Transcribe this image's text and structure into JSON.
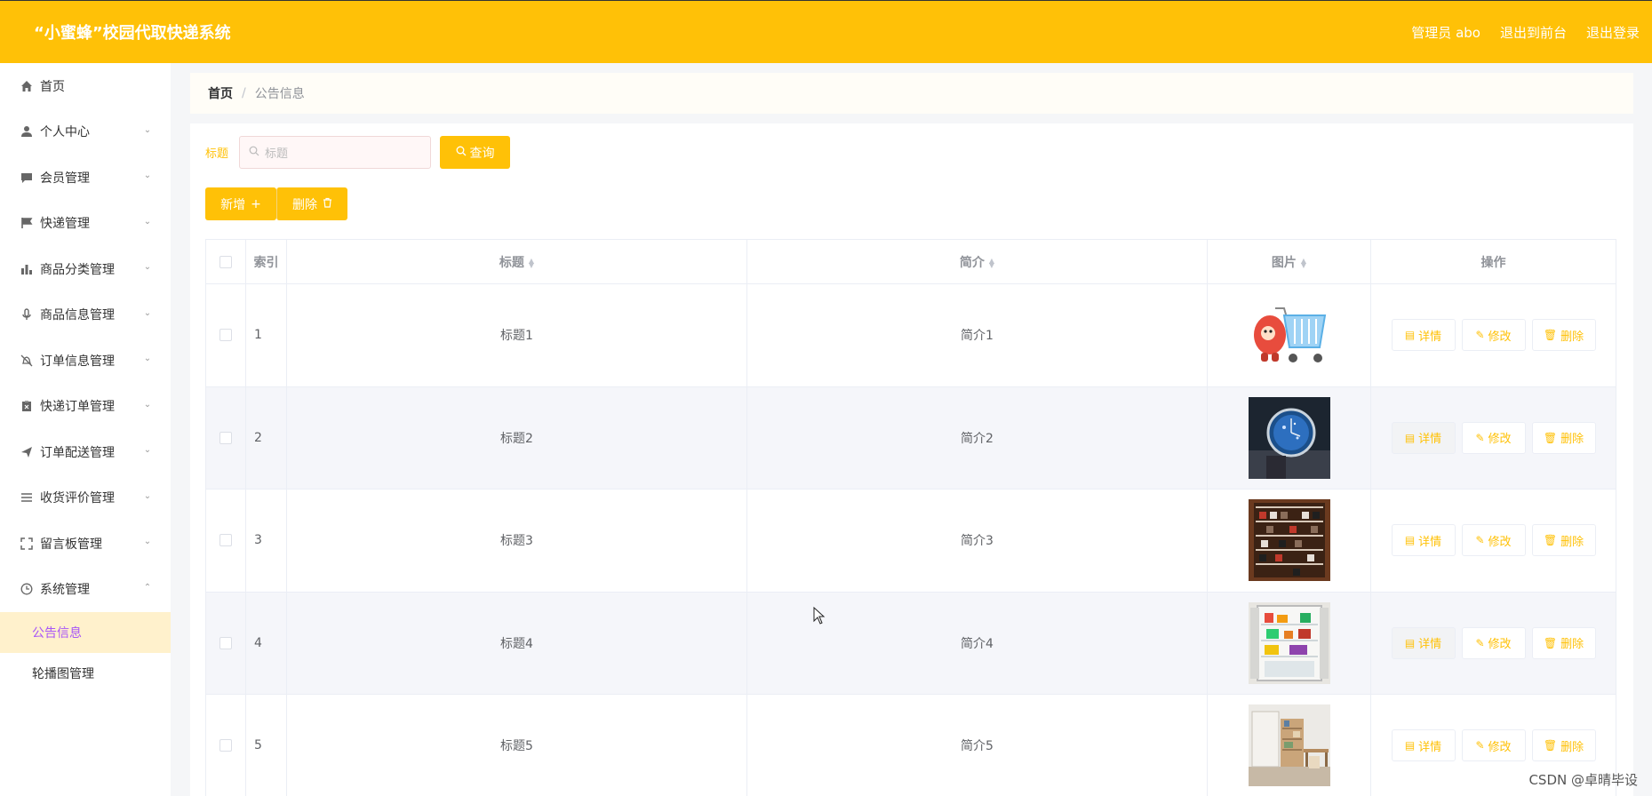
{
  "header": {
    "title": "“小蜜蜂”校园代取快递系统",
    "admin": "管理员 abo",
    "to_front": "退出到前台",
    "logout": "退出登录"
  },
  "sidebar": {
    "items": [
      {
        "label": "首页",
        "icon": "home-icon"
      },
      {
        "label": "个人中心",
        "icon": "user-icon"
      },
      {
        "label": "会员管理",
        "icon": "chat-icon"
      },
      {
        "label": "快递管理",
        "icon": "flag-icon"
      },
      {
        "label": "商品分类管理",
        "icon": "bar-chart-icon"
      },
      {
        "label": "商品信息管理",
        "icon": "microphone-icon"
      },
      {
        "label": "订单信息管理",
        "icon": "bell-off-icon"
      },
      {
        "label": "快递订单管理",
        "icon": "clipboard-icon"
      },
      {
        "label": "订单配送管理",
        "icon": "send-icon"
      },
      {
        "label": "收货评价管理",
        "icon": "list-icon"
      },
      {
        "label": "留言板管理",
        "icon": "fullscreen-icon"
      },
      {
        "label": "系统管理",
        "icon": "clock-icon"
      }
    ],
    "sub_items": [
      {
        "label": "公告信息",
        "active": true
      },
      {
        "label": "轮播图管理",
        "active": false
      }
    ]
  },
  "breadcrumb": {
    "home": "首页",
    "separator": "/",
    "current": "公告信息"
  },
  "search": {
    "label": "标题",
    "placeholder": "标题",
    "button": "查询"
  },
  "actions": {
    "add": "新增",
    "delete": "删除"
  },
  "table": {
    "headers": {
      "index": "索引",
      "title": "标题",
      "intro": "简介",
      "image": "图片",
      "ops": "操作"
    },
    "op_labels": {
      "detail": "详情",
      "edit": "修改",
      "delete": "删除"
    },
    "rows": [
      {
        "index": "1",
        "title": "标题1",
        "intro": "简介1",
        "image": "shopping-cart-mascot"
      },
      {
        "index": "2",
        "title": "标题2",
        "intro": "简介2",
        "image": "wristwatch-photo"
      },
      {
        "index": "3",
        "title": "标题3",
        "intro": "简介3",
        "image": "shoe-rack-photo"
      },
      {
        "index": "4",
        "title": "标题4",
        "intro": "简介4",
        "image": "refrigerator-photo"
      },
      {
        "index": "5",
        "title": "标题5",
        "intro": "简介5",
        "image": "study-room-photo"
      }
    ]
  },
  "watermark": "CSDN @卓晴毕设",
  "colors": {
    "accent": "#ffc107",
    "active_bg": "#fff1cc",
    "active_text": "#a855f7"
  }
}
